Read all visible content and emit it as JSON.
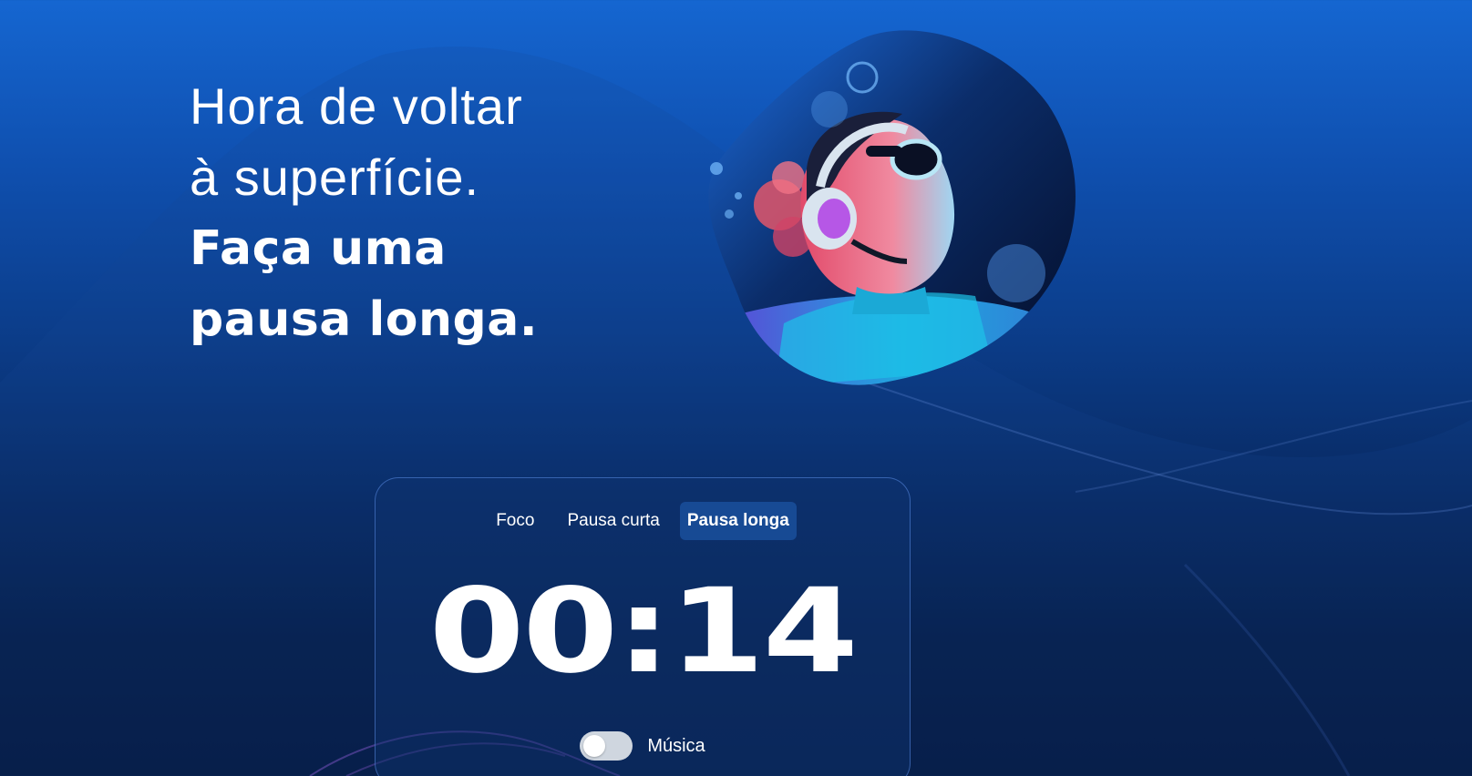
{
  "hero": {
    "line1": "Hora de voltar",
    "line2": "à superfície.",
    "line3": "Faça uma",
    "line4": "pausa longa."
  },
  "illustration": {
    "icon": "diver-with-headphones-illustration"
  },
  "tabs": [
    {
      "label": "Foco",
      "active": false
    },
    {
      "label": "Pausa curta",
      "active": false
    },
    {
      "label": "Pausa longa",
      "active": true
    }
  ],
  "timer": {
    "value": "00:14"
  },
  "music": {
    "label": "Música",
    "enabled": false
  },
  "colors": {
    "accent": "#174a94",
    "background_top": "#1566d1",
    "background_bottom": "#04163a"
  }
}
